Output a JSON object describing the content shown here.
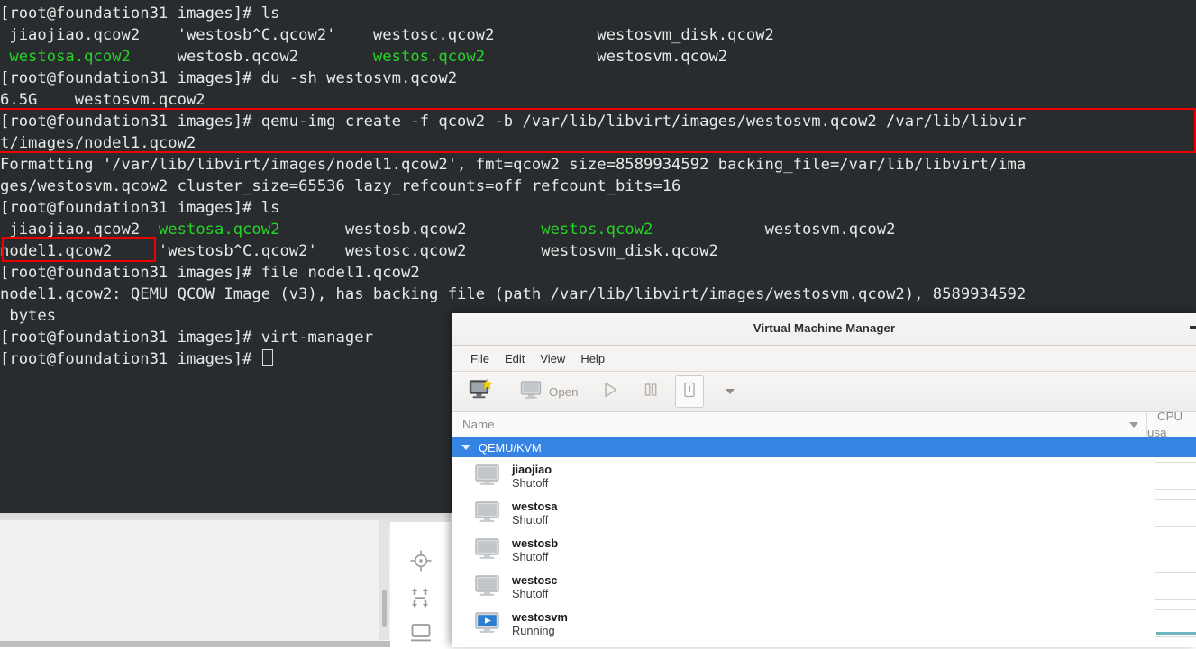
{
  "terminal": {
    "bg_color": "#282c2e",
    "fg_color": "#e6e6e6",
    "green_color": "#26d426",
    "highlight_color": "#ee0000",
    "prompt": "[root@foundation31 images]# ",
    "lines": [
      {
        "type": "prompt",
        "command": "ls"
      },
      {
        "type": "ls",
        "cells": [
          {
            "text": " jiaojiao.qcow2",
            "color": "white"
          },
          {
            "text": "'westosb^C.qcow2'",
            "color": "white"
          },
          {
            "text": "westosc.qcow2",
            "color": "white"
          },
          {
            "text": "westosvm_disk.qcow2",
            "color": "white"
          }
        ]
      },
      {
        "type": "ls",
        "cells": [
          {
            "text": " westosa.qcow2",
            "color": "green"
          },
          {
            "text": "westosb.qcow2",
            "color": "white"
          },
          {
            "text": "westos.qcow2",
            "color": "green"
          },
          {
            "text": "westosvm.qcow2",
            "color": "white"
          }
        ]
      },
      {
        "type": "prompt",
        "command": "du -sh westosvm.qcow2"
      },
      {
        "type": "output",
        "text": "6.5G    westosvm.qcow2"
      },
      {
        "type": "prompt",
        "command": "qemu-img create -f qcow2 -b /var/lib/libvirt/images/westosvm.qcow2 /var/lib/libvir"
      },
      {
        "type": "output",
        "text": "t/images/nodel1.qcow2"
      },
      {
        "type": "output",
        "text": "Formatting '/var/lib/libvirt/images/nodel1.qcow2', fmt=qcow2 size=8589934592 backing_file=/var/lib/libvirt/ima"
      },
      {
        "type": "output",
        "text": "ges/westosvm.qcow2 cluster_size=65536 lazy_refcounts=off refcount_bits=16"
      },
      {
        "type": "prompt",
        "command": "ls"
      },
      {
        "type": "ls2",
        "cells": [
          {
            "text": " jiaojiao.qcow2",
            "color": "white"
          },
          {
            "text": "westosa.qcow2",
            "color": "green"
          },
          {
            "text": "westosb.qcow2",
            "color": "white"
          },
          {
            "text": "westos.qcow2",
            "color": "green"
          },
          {
            "text": "westosvm.qcow2",
            "color": "white"
          }
        ]
      },
      {
        "type": "ls2",
        "cells": [
          {
            "text": "nodel1.qcow2",
            "color": "white"
          },
          {
            "text": "'westosb^C.qcow2'",
            "color": "white"
          },
          {
            "text": "westosc.qcow2",
            "color": "white"
          },
          {
            "text": "westosvm_disk.qcow2",
            "color": "white"
          },
          {
            "text": "",
            "color": "white"
          }
        ]
      },
      {
        "type": "prompt",
        "command": "file nodel1.qcow2"
      },
      {
        "type": "output",
        "text": "nodel1.qcow2: QEMU QCOW Image (v3), has backing file (path /var/lib/libvirt/images/westosvm.qcow2), 8589934592"
      },
      {
        "type": "output",
        "text": " bytes"
      },
      {
        "type": "prompt",
        "command": "virt-manager"
      },
      {
        "type": "prompt_cursor",
        "command": ""
      }
    ],
    "annotations": [
      {
        "name": "qemu-img-create-command-highlight"
      },
      {
        "name": "nodel1-qcow2-filename-highlight"
      }
    ]
  },
  "bottom_panel": {
    "icons": [
      {
        "name": "target-icon",
        "glyph": "target"
      },
      {
        "name": "expand-arrows-icon",
        "glyph": "expand"
      },
      {
        "name": "display-icon",
        "glyph": "display"
      }
    ]
  },
  "vmm": {
    "title": "Virtual Machine Manager",
    "minimize_label": "Minimize",
    "menu": [
      "File",
      "Edit",
      "View",
      "Help"
    ],
    "toolbar": {
      "new_vm_tooltip": "Create a new virtual machine",
      "open_label": "Open",
      "run_tooltip": "Run",
      "pause_tooltip": "Pause",
      "shutdown_tooltip": "Shut down",
      "dropdown_tooltip": "More options"
    },
    "columns": {
      "name": "Name",
      "cpu": "CPU usa"
    },
    "group": {
      "label": "QEMU/KVM",
      "expanded": true
    },
    "vms": [
      {
        "name": "jiaojiao",
        "state": "Shutoff",
        "running": false
      },
      {
        "name": "westosa",
        "state": "Shutoff",
        "running": false
      },
      {
        "name": "westosb",
        "state": "Shutoff",
        "running": false
      },
      {
        "name": "westosc",
        "state": "Shutoff",
        "running": false
      },
      {
        "name": "westosvm",
        "state": "Running",
        "running": true
      }
    ]
  }
}
